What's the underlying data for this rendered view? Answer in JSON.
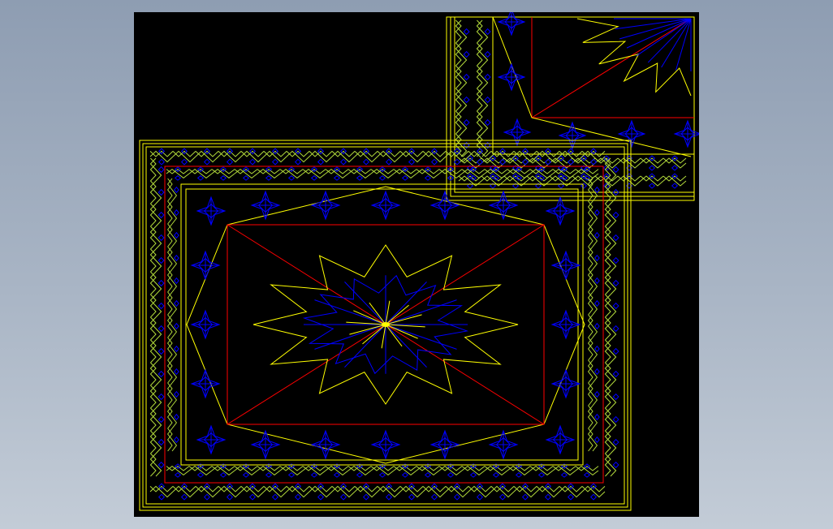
{
  "viewport": {
    "background": "#000000"
  },
  "drawing": {
    "description_colors": {
      "outline": "#ffff00",
      "diagonal": "#ff0000",
      "ornament": "#0000ff",
      "border_pattern": "#b4dc3c"
    },
    "panels": [
      {
        "id": "main-panel",
        "has_rosette": true,
        "has_border_band": true
      },
      {
        "id": "corner-panel",
        "has_rosette": true,
        "has_border_band": true
      }
    ]
  }
}
